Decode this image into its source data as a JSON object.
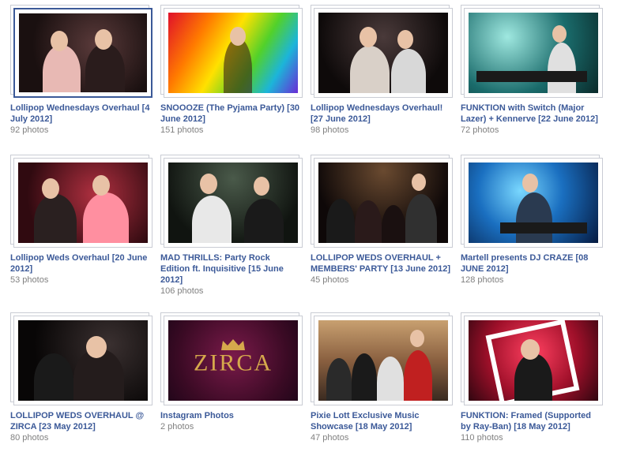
{
  "albums": [
    {
      "title": "Lollipop Wednesdays Overhaul [4 July 2012]",
      "count": "92 photos"
    },
    {
      "title": "SNOOOZE (The Pyjama Party) [30 June 2012]",
      "count": "151 photos"
    },
    {
      "title": "Lollipop Wednesdays Overhaul! [27 June 2012]",
      "count": "98 photos"
    },
    {
      "title": "FUNKTION with Switch (Major Lazer) + Kennerve [22 June 2012]",
      "count": "72 photos"
    },
    {
      "title": "Lollipop Weds Overhaul [20 June 2012]",
      "count": "53 photos"
    },
    {
      "title": "MAD THRILLS: Party Rock Edition ft. Inquisitive [15 June 2012]",
      "count": "106 photos"
    },
    {
      "title": "LOLLIPOP WEDS OVERHAUL + MEMBERS' PARTY [13 June 2012]",
      "count": "45 photos"
    },
    {
      "title": "Martell presents DJ CRAZE [08 JUNE 2012]",
      "count": "128 photos"
    },
    {
      "title": "LOLLIPOP WEDS OVERHAUL @ ZIRCA [23 May 2012]",
      "count": "80 photos"
    },
    {
      "title": "Instagram Photos",
      "count": "2 photos"
    },
    {
      "title": "Pixie Lott Exclusive Music Showcase [18 May 2012]",
      "count": "47 photos"
    },
    {
      "title": "FUNKTION: Framed (Supported by Ray-Ban) [18 May 2012]",
      "count": "110 photos"
    }
  ],
  "instagram_cover_text": "ZIRCA",
  "colors": {
    "link": "#3b5998",
    "count": "#808080"
  }
}
